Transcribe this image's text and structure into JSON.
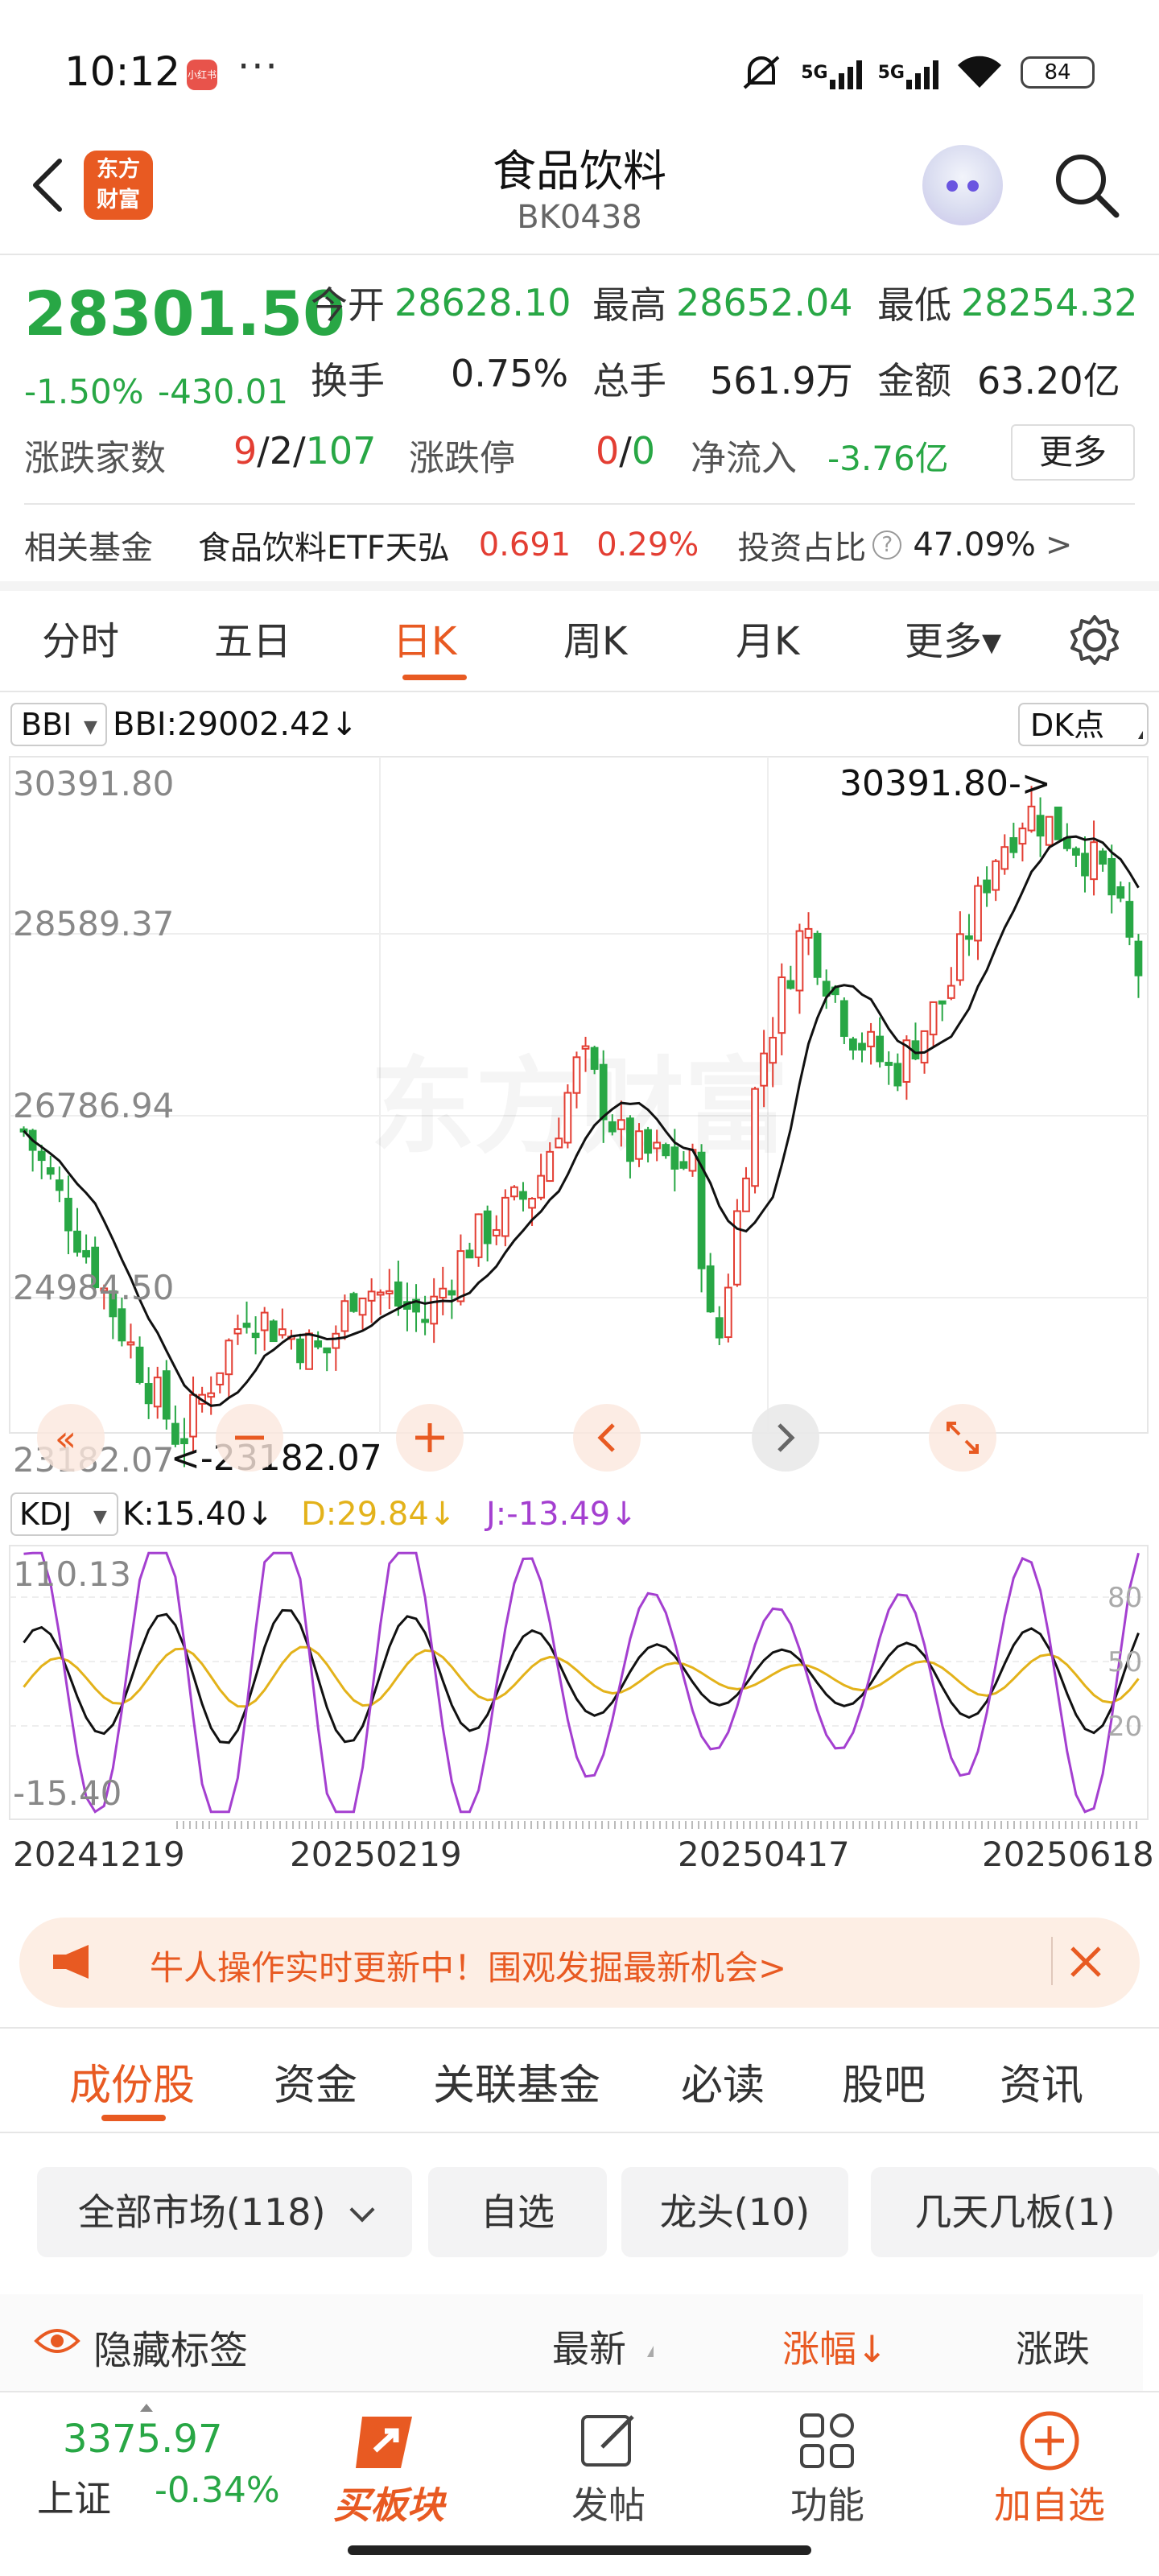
{
  "status": {
    "time": "10:12",
    "app_icon_text": "小红书",
    "dots": "···",
    "signal1": "5G",
    "signal2": "5G",
    "battery": "84"
  },
  "nav": {
    "logo_line1": "东方",
    "logo_line2": "财富",
    "title": "食品饮料",
    "code": "BK0438"
  },
  "quote": {
    "price": "28301.50",
    "change_pct": "-1.50%",
    "change_abs": "-430.01",
    "open_label": "今开",
    "open": "28628.10",
    "high_label": "最高",
    "high": "28652.04",
    "low_label": "最低",
    "low": "28254.32",
    "turnover_label": "换手",
    "turnover": "0.75%",
    "volume_label": "总手",
    "volume": "561.9万",
    "amount_label": "金额",
    "amount": "63.20亿",
    "updown_label": "涨跌家数",
    "up_count": "9",
    "flat_count": "2",
    "down_count": "107",
    "sep": "/",
    "limit_label": "涨跌停",
    "limit_up": "0",
    "limit_down": "0",
    "netflow_label": "净流入",
    "netflow": "-3.76亿",
    "more_label": "更多"
  },
  "fund": {
    "label": "相关基金",
    "name": "食品饮料ETF天弘",
    "price": "0.691",
    "pct": "0.29%",
    "ratio_label": "投资占比",
    "help": "?",
    "ratio": "47.09%",
    "arrow": ">"
  },
  "ktabs": [
    "分时",
    "五日",
    "日K",
    "周K",
    "月K",
    "更多▾"
  ],
  "chart": {
    "main_indicator": "BBI",
    "main_value": "BBI:29002.42↓",
    "dk_label": "DK点",
    "y_labels": [
      "30391.80",
      "28589.37",
      "26786.94",
      "24984.50",
      "23182.07"
    ],
    "high_annotation": "30391.80->",
    "low_annotation": "<-23182.07",
    "watermark": "东方财富",
    "sub_indicator": "KDJ",
    "k_value": "K:15.40↓",
    "d_value": "D:29.84↓",
    "j_value": "J:-13.49↓",
    "sub_top": "110.13",
    "sub_bottom": "-15.40",
    "sub_marks": [
      "80",
      "50",
      "20"
    ],
    "dates": [
      "20241219",
      "20250219",
      "20250417",
      "20250618"
    ],
    "colors": {
      "up": "#e33e33",
      "down": "#28a745",
      "k": "#111111",
      "d": "#e3b21a",
      "j": "#a43fd0"
    }
  },
  "promo": {
    "text": "牛人操作实时更新中！围观发掘最新机会>"
  },
  "btabs": [
    "成份股",
    "资金",
    "关联基金",
    "必读",
    "股吧",
    "资讯"
  ],
  "filters": [
    "全部市场(118)",
    "自选",
    "龙头(10)",
    "几天几板(1)"
  ],
  "list_header": {
    "hide": "隐藏标签",
    "latest": "最新",
    "change": "涨幅↓",
    "updown": "涨跌"
  },
  "bottom": {
    "index_value": "3375.97",
    "index_name": "上证",
    "index_pct": "-0.34%",
    "buy_label": "买板块",
    "post_label": "发帖",
    "func_label": "功能",
    "add_label": "加自选"
  }
}
